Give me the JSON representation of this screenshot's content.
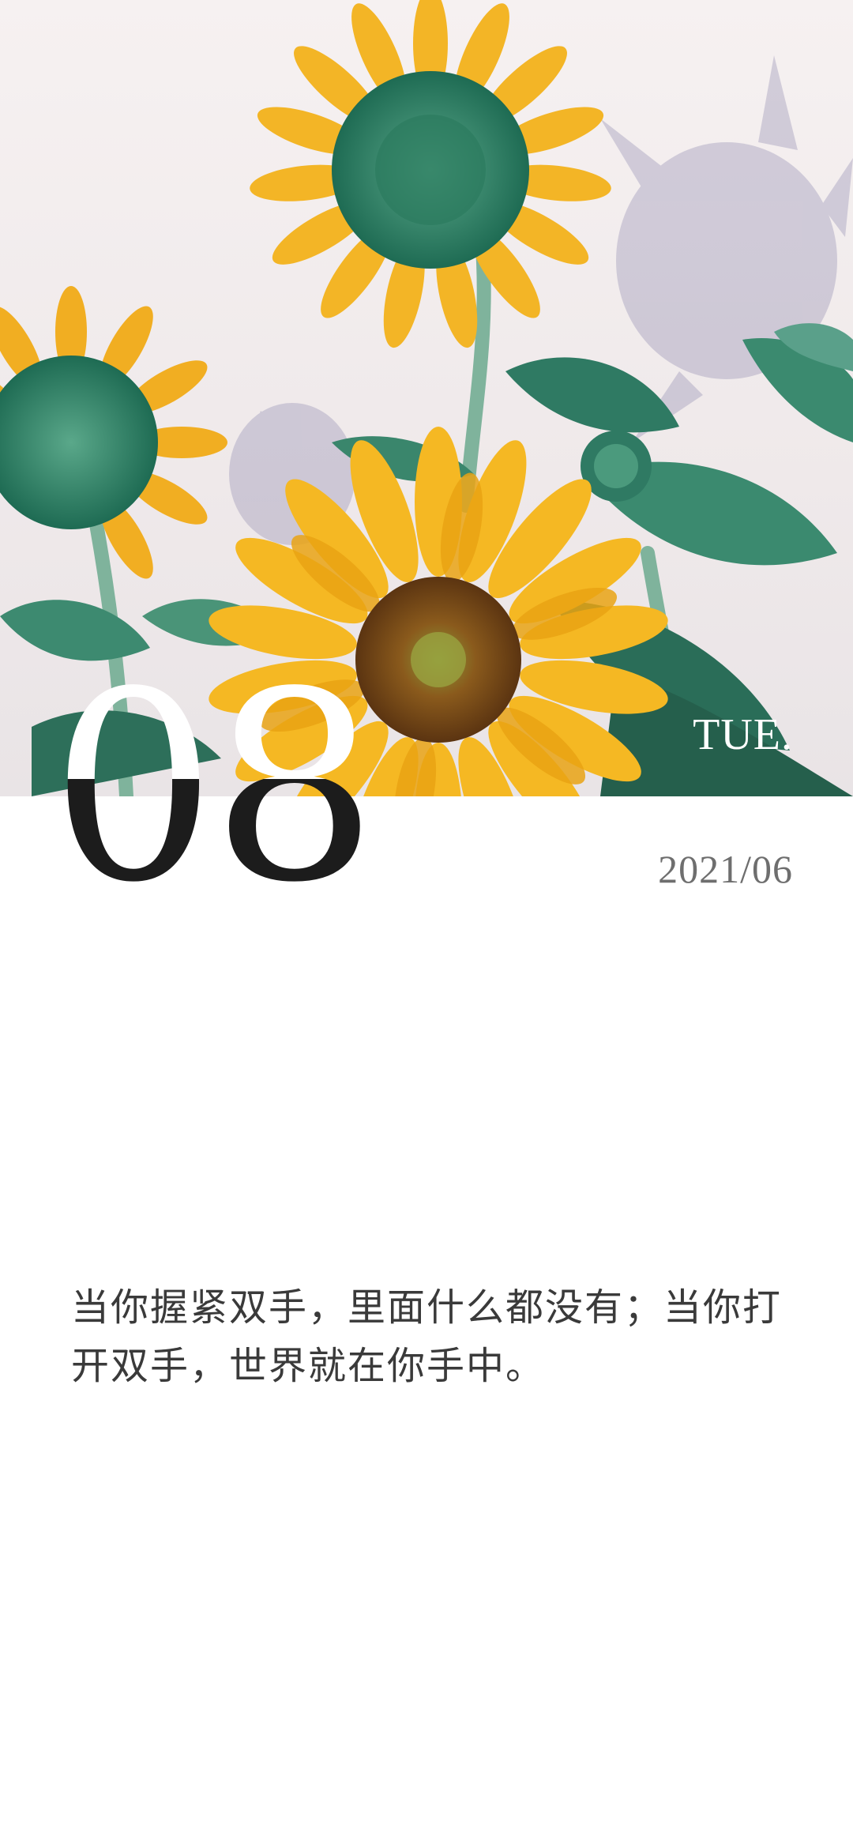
{
  "calendar": {
    "day": "08",
    "weekday": "TUE.",
    "year_month": "2021/06"
  },
  "quote": {
    "text": "当你握紧双手，里面什么都没有；当你打开双手，世界就在你手中。"
  },
  "colors": {
    "background": "#ffffff",
    "day_number": "#1d1d1d",
    "year_month": "#6e6e6e",
    "quote": "#3a3a3a",
    "petal": "#f3b526",
    "leaf": "#2f7a63"
  }
}
